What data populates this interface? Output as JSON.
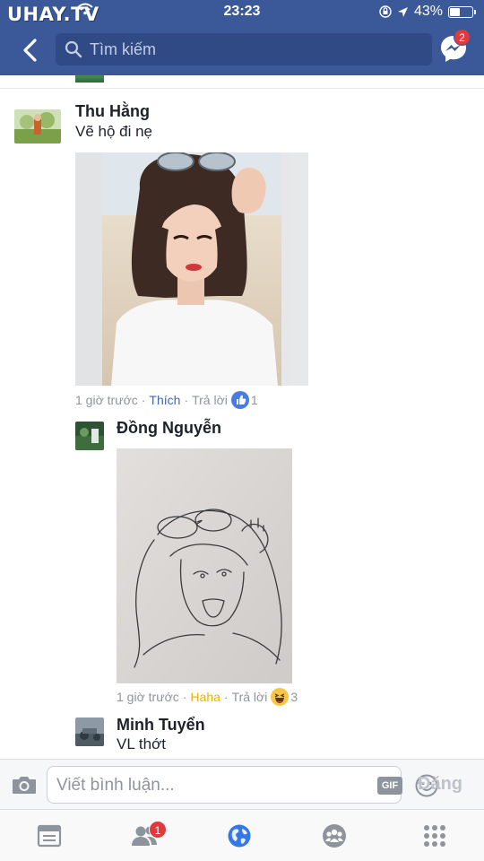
{
  "status_bar": {
    "watermark": "UHAY.TV",
    "time": "23:23",
    "battery": "43%"
  },
  "header": {
    "search_placeholder": "Tìm kiếm",
    "messenger_badge": "2"
  },
  "comments": [
    {
      "author": "Thu Hằng",
      "text": "Vẽ hộ đi nẹ",
      "time": "1 giờ trước",
      "action_react": "Thích",
      "action_reply": "Trả lời",
      "reaction_count": "1",
      "reaction_icon": "like-icon"
    },
    {
      "author": "Đồng Nguyễn",
      "time": "1 giờ trước",
      "action_react": "Haha",
      "action_reply": "Trả lời",
      "reaction_count": "3",
      "reaction_icon": "haha-icon"
    },
    {
      "author": "Minh Tuyển",
      "text": "VL thớt"
    }
  ],
  "composer": {
    "placeholder": "Viết bình luận...",
    "gif_label": "GIF",
    "post_label": "Đăng"
  },
  "tabbar": {
    "friends_badge": "1"
  },
  "colors": {
    "brand": "#3b5998",
    "liked": "#4267b2",
    "haha": "#e7b400",
    "badge": "#e0393e"
  }
}
